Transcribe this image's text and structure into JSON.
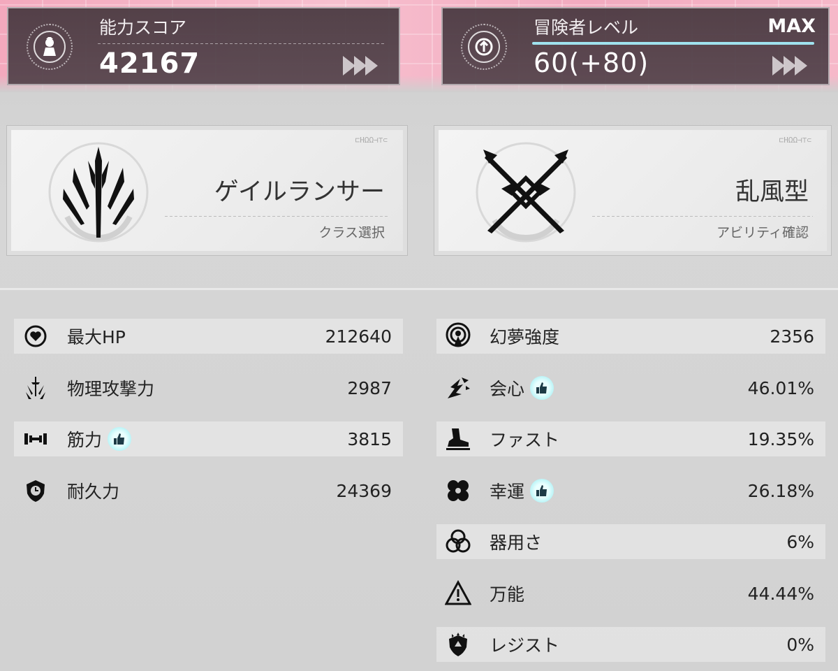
{
  "header": {
    "score": {
      "label": "能力スコア",
      "value": "42167"
    },
    "level": {
      "label": "冒険者レベル",
      "max_label": "MAX",
      "value": "60(+80)"
    }
  },
  "cards": {
    "class": {
      "code": "⊏ΗΩΩ⊣⊤⊂",
      "title": "ゲイルランサー",
      "action": "クラス選択"
    },
    "ability": {
      "code": "⊏ΗΩΩ⊣⊤⊂",
      "title": "乱風型",
      "action": "アビリティ確認"
    }
  },
  "stats_left": [
    {
      "icon": "heart-icon",
      "label": "最大HP",
      "value": "212640",
      "recommended": false
    },
    {
      "icon": "sword-icon",
      "label": "物理攻撃力",
      "value": "2987",
      "recommended": false
    },
    {
      "icon": "dumbbell-icon",
      "label": "筋力",
      "value": "3815",
      "recommended": true
    },
    {
      "icon": "shield-icon",
      "label": "耐久力",
      "value": "24369",
      "recommended": false
    }
  ],
  "stats_right": [
    {
      "icon": "broadcast-icon",
      "label": "幻夢強度",
      "value": "2356",
      "recommended": false
    },
    {
      "icon": "critical-icon",
      "label": "会心",
      "value": "46.01%",
      "recommended": true
    },
    {
      "icon": "boot-icon",
      "label": "ファスト",
      "value": "19.35%",
      "recommended": false
    },
    {
      "icon": "clover-icon",
      "label": "幸運",
      "value": "26.18%",
      "recommended": true
    },
    {
      "icon": "rings-icon",
      "label": "器用さ",
      "value": "6%",
      "recommended": false
    },
    {
      "icon": "warning-icon",
      "label": "万能",
      "value": "44.44%",
      "recommended": false
    },
    {
      "icon": "resist-shield-icon",
      "label": "レジスト",
      "value": "0%",
      "recommended": false
    }
  ],
  "colors": {
    "accent_bar": "#9fe2ee",
    "panel": "#4a3a42",
    "pink_bg": "#f3a9bd"
  }
}
